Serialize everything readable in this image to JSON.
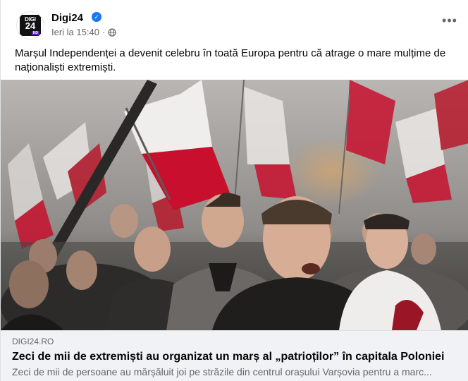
{
  "post": {
    "page_name": "Digi24",
    "avatar_logo": {
      "top": "DIGI",
      "num": "24",
      "badge": "HD"
    },
    "timestamp": "Ieri la 15:40",
    "separator": "·",
    "text": "Marșul Independenței a devenit celebru în toată Europa pentru că atrage o mare mulțime de naționaliști extremiști.",
    "icons": {
      "verified": "verified-badge-icon",
      "audience": "globe-icon",
      "more": "more-options-icon"
    }
  },
  "link_preview": {
    "domain": "DIGI24.RO",
    "title": "Zeci de mii de extremiști au organizat un marș al „patrioților” în capitala Poloniei",
    "description": "Zeci de mii de persoane au mărșăluit joi pe străzile din centrul orașului Varșovia pentru a marc..."
  },
  "colors": {
    "verified": "#1877f2",
    "link_bg": "#f0f2f5",
    "secondary_text": "#65676b",
    "flag_red": "#c8102e",
    "flag_white": "#f2f2f2"
  }
}
